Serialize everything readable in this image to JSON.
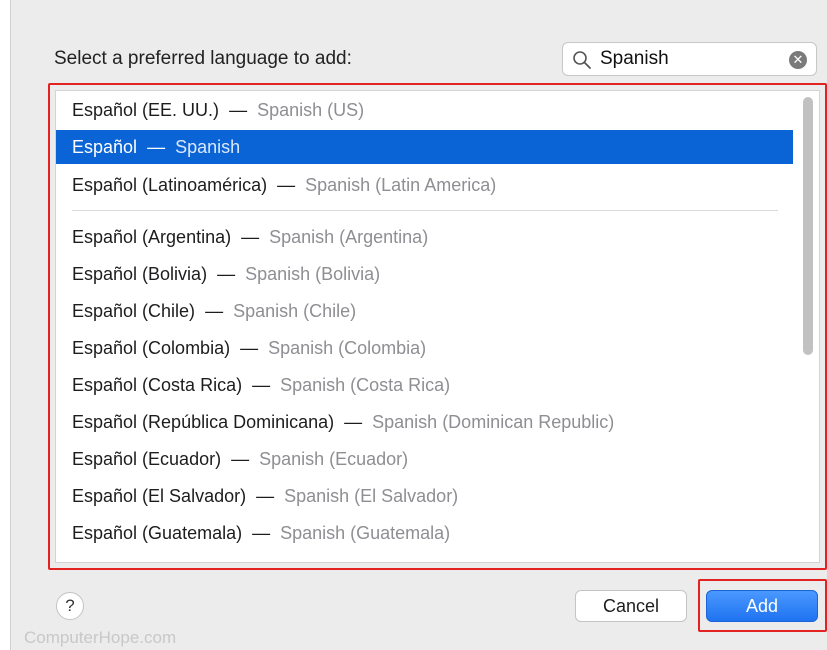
{
  "prompt_label": "Select a preferred language to add:",
  "search": {
    "value": "Spanish",
    "icon": "magnifying-glass-icon",
    "clear_icon": "clear-x-icon"
  },
  "languages": [
    {
      "native": "Español (EE. UU.)",
      "english": "Spanish (US)",
      "selected": false
    },
    {
      "native": "Español",
      "english": "Spanish",
      "selected": true
    },
    {
      "native": "Español (Latinoamérica)",
      "english": "Spanish (Latin America)",
      "selected": false
    },
    {
      "native": "Español (Argentina)",
      "english": "Spanish (Argentina)",
      "selected": false
    },
    {
      "native": "Español (Bolivia)",
      "english": "Spanish (Bolivia)",
      "selected": false
    },
    {
      "native": "Español (Chile)",
      "english": "Spanish (Chile)",
      "selected": false
    },
    {
      "native": "Español (Colombia)",
      "english": "Spanish (Colombia)",
      "selected": false
    },
    {
      "native": "Español (Costa Rica)",
      "english": "Spanish (Costa Rica)",
      "selected": false
    },
    {
      "native": "Español (República Dominicana)",
      "english": "Spanish (Dominican Republic)",
      "selected": false
    },
    {
      "native": "Español (Ecuador)",
      "english": "Spanish (Ecuador)",
      "selected": false
    },
    {
      "native": "Español (El Salvador)",
      "english": "Spanish (El Salvador)",
      "selected": false
    },
    {
      "native": "Español (Guatemala)",
      "english": "Spanish (Guatemala)",
      "selected": false
    }
  ],
  "separator": "—",
  "footer": {
    "help_label": "?",
    "cancel_label": "Cancel",
    "add_label": "Add"
  },
  "watermark": "ComputerHope.com",
  "colors": {
    "selection": "#0a64d6",
    "highlight_box": "#e32222",
    "add_button": "#1f73f0"
  }
}
